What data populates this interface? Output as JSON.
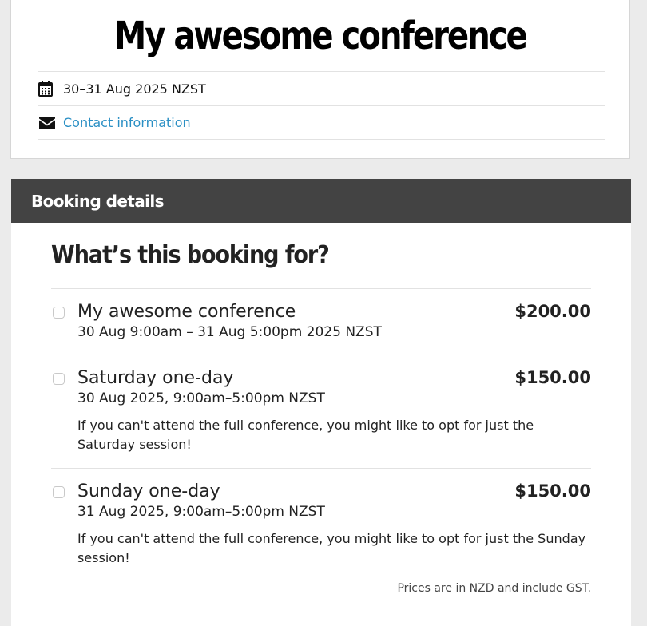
{
  "event": {
    "title": "My awesome conference",
    "date": "30–31 Aug 2025 NZST",
    "contact_link": "Contact information"
  },
  "booking": {
    "bar_title": "Booking details",
    "heading": "What’s this booking for?",
    "options": [
      {
        "name": "My awesome conference",
        "price": "$200.00",
        "date": "30 Aug 9:00am – 31 Aug 5:00pm 2025 NZST",
        "description": ""
      },
      {
        "name": "Saturday one-day",
        "price": "$150.00",
        "date": "30 Aug 2025, 9:00am–5:00pm NZST",
        "description": "If you can't attend the full conference, you might like to opt for just the Saturday session!"
      },
      {
        "name": "Sunday one-day",
        "price": "$150.00",
        "date": "31 Aug 2025, 9:00am–5:00pm NZST",
        "description": "If you can't attend the full conference, you might like to opt for just the Sunday session!"
      }
    ],
    "footnote": "Prices are in NZD and include GST."
  },
  "icons": {
    "date": "calendar-icon",
    "contact": "envelope-icon"
  },
  "colors": {
    "link": "#2a8fc4",
    "bar_background": "#434343"
  }
}
